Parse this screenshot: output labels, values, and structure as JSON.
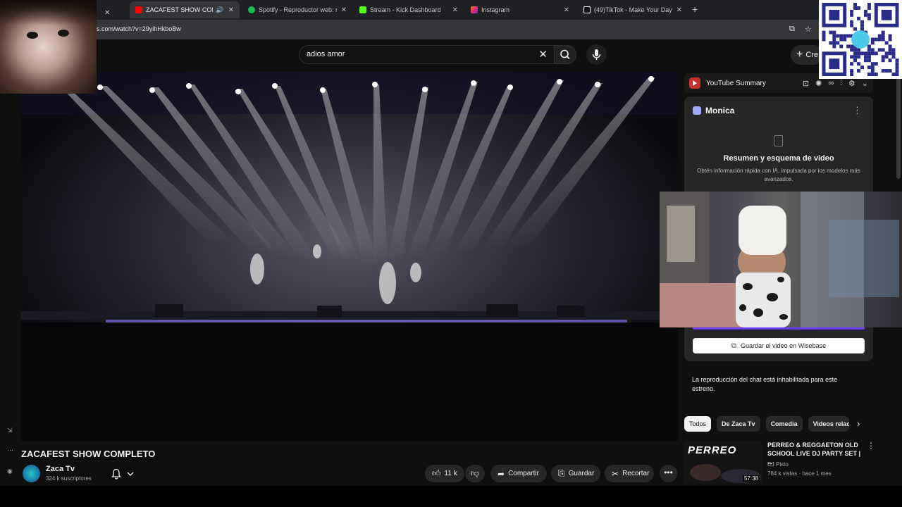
{
  "browser": {
    "tabs": [
      {
        "title": "ZACAFEST SHOW COMPLETO",
        "icon": "youtube-icon",
        "color": "#ff0000",
        "active": true,
        "audio": true
      },
      {
        "title": "Spotify - Reproductor web: música",
        "icon": "spotify-icon",
        "color": "#1db954"
      },
      {
        "title": "Stream - Kick Dashboard",
        "icon": "kick-icon",
        "color": "#53fc18"
      },
      {
        "title": "Instagram",
        "icon": "instagram-icon",
        "color": "#e1306c"
      },
      {
        "title": "(49)TikTok - Make Your Day",
        "icon": "tiktok-icon",
        "color": "#ffffff"
      }
    ],
    "address": "s.com/watch?v=29yihHkboBw"
  },
  "header": {
    "search_value": "adios amor",
    "create_label": "Cre"
  },
  "video": {
    "title": "ZACAFEST SHOW COMPLETO",
    "channel": "Zaca Tv",
    "subscribers": "324 k suscriptores",
    "likes": "11 k",
    "share_label": "Compartir",
    "save_label": "Guardar",
    "clip_label": "Recortar"
  },
  "panel": {
    "extension_title": "YouTube Summary",
    "monica_title": "Monica",
    "summary_title": "Resumen y esquema de video",
    "summary_sub": "Obtén información rápida con IA, impulsada por los modelos más avanzados.",
    "wisebase_label": "Guardar el video en Wisebase",
    "chat_message": "La reproducción del chat está inhabilitada para este estreno."
  },
  "chips": [
    "Todos",
    "De Zaca Tv",
    "Comedia",
    "Videos relac"
  ],
  "recommendation": {
    "thumb_text": "PERREO",
    "duration": "57:38",
    "title": "PERREO & REGGAETON OLD SCHOOL LIVE DJ PARTY SET | ...",
    "channel": "DJ Pisto",
    "meta": "784 k vistas · hace 1 mes"
  },
  "colors": {
    "accent": "#ff0000",
    "background": "#0f0f0f",
    "chip_bg": "#272727",
    "wisebase_accent": "#6a3cf5"
  }
}
